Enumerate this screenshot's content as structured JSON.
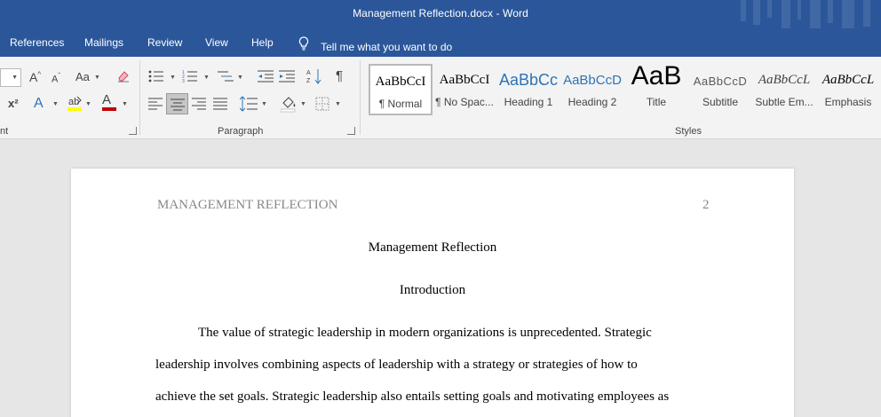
{
  "window": {
    "title": "Management Reflection.docx  -  Word"
  },
  "tabs": [
    {
      "label": "References"
    },
    {
      "label": "Mailings"
    },
    {
      "label": "Review"
    },
    {
      "label": "View"
    },
    {
      "label": "Help"
    }
  ],
  "tell_me": {
    "label": "Tell me what you want to do"
  },
  "ribbon": {
    "groups": {
      "font": "nt",
      "paragraph": "Paragraph",
      "styles": "Styles"
    },
    "font_buttons": {
      "grow": "A",
      "shrink": "A",
      "case": "Aa",
      "superscript": "x²",
      "text_effects": "A",
      "font_color": "A"
    },
    "paragraph_buttons": {
      "pilcrow": "¶"
    },
    "colors": {
      "highlight": "#ffff00",
      "font_color": "#c00000",
      "text_effects": "#2e75b6"
    },
    "styles": [
      {
        "sample": "AaBbCcI",
        "name": "¶ Normal",
        "color": "#000000",
        "selected": true
      },
      {
        "sample": "AaBbCcI",
        "name": "¶ No Spac...",
        "color": "#000000"
      },
      {
        "sample": "AaBbCc",
        "name": "Heading 1",
        "color": "#2e74b5"
      },
      {
        "sample": "AaBbCcD",
        "name": "Heading 2",
        "color": "#2e74b5"
      },
      {
        "sample": "AaB",
        "name": "Title",
        "color": "#000000"
      },
      {
        "sample": "AaBbCcD",
        "name": "Subtitle",
        "color": "#595959"
      },
      {
        "sample": "AaBbCcL",
        "name": "Subtle Em...",
        "color": "#404040"
      },
      {
        "sample": "AaBbCcL",
        "name": "Emphasis",
        "color": "#000000"
      }
    ]
  },
  "document": {
    "header_left": "MANAGEMENT REFLECTION",
    "page_number": "2",
    "title": "Management Reflection",
    "subtitle": "Introduction",
    "lines": [
      "The value of strategic leadership in modern organizations is unprecedented. Strategic",
      "leadership involves combining aspects of leadership with a strategy or strategies of how to",
      "achieve the set goals. Strategic leadership also entails setting goals and motivating employees as"
    ]
  }
}
